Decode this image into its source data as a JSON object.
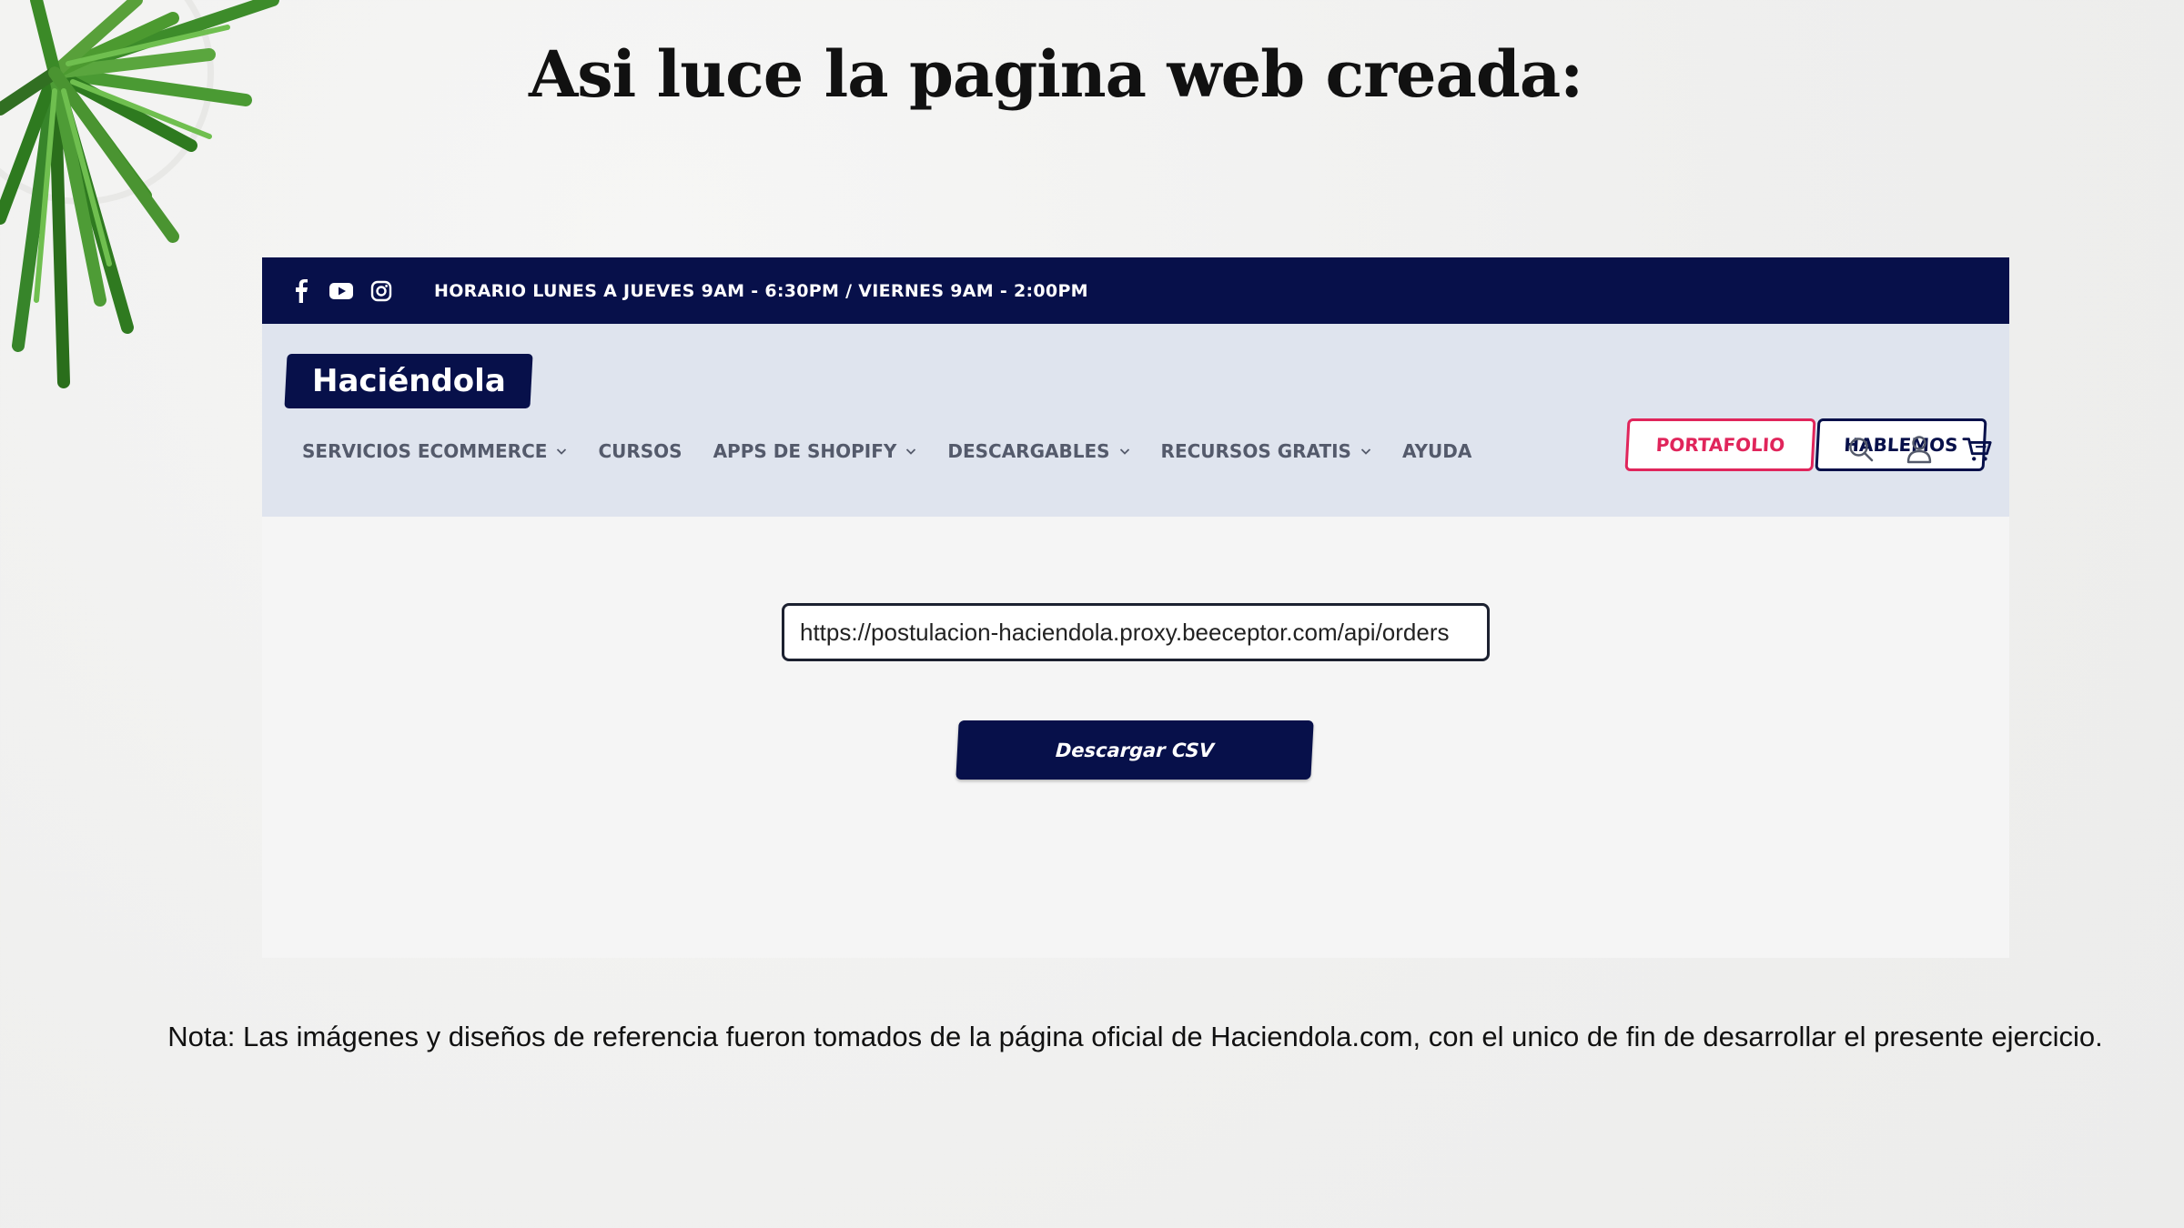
{
  "slide": {
    "title": "Asi luce la pagina web creada:",
    "note": "Nota: Las imágenes y diseños de referencia fueron tomados de la página oficial de Haciendola.com, con el unico de fin de desarrollar el presente ejercicio."
  },
  "site": {
    "topbar": {
      "social_icons": [
        "facebook-icon",
        "youtube-icon",
        "instagram-icon"
      ],
      "hours": "HORARIO LUNES A JUEVES 9AM - 6:30PM / VIERNES 9AM - 2:00PM"
    },
    "logo": "Haciéndola",
    "buttons": {
      "portafolio": "PORTAFOLIO",
      "hablemos": "HABLEMOS"
    },
    "nav": [
      {
        "label": "SERVICIOS ECOMMERCE",
        "has_dropdown": true
      },
      {
        "label": "CURSOS",
        "has_dropdown": false
      },
      {
        "label": "APPS DE SHOPIFY",
        "has_dropdown": true
      },
      {
        "label": "DESCARGABLES",
        "has_dropdown": true
      },
      {
        "label": "RECURSOS GRATIS",
        "has_dropdown": true
      },
      {
        "label": "AYUDA",
        "has_dropdown": false
      }
    ],
    "header_icons": [
      "search-icon",
      "account-icon",
      "cart-icon"
    ],
    "url_input": {
      "value": "https://postulacion-haciendola.proxy.beeceptor.com/api/orders"
    },
    "download_button": "Descargar CSV"
  },
  "colors": {
    "navy": "#07104a",
    "pink": "#e0255b",
    "header_bg": "#dfe4ee",
    "nav_text": "#545a6b"
  }
}
